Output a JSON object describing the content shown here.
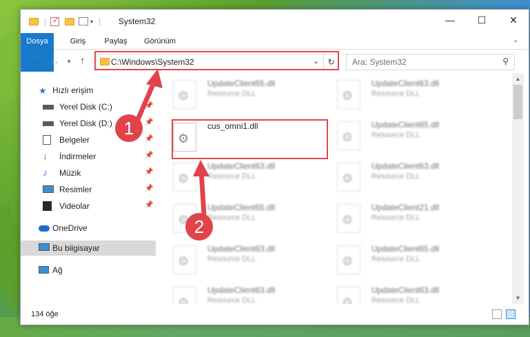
{
  "window": {
    "title": "System32",
    "controls": {
      "minimize": "—",
      "maximize": "☐",
      "close": "✕"
    }
  },
  "ribbon": {
    "tabs": [
      "Dosya",
      "Giriş",
      "Paylaş",
      "Görünüm"
    ]
  },
  "nav": {
    "address": "C:\\Windows\\System32",
    "search_placeholder": "Ara: System32"
  },
  "sidebar": {
    "items": [
      {
        "label": "Hızlı erişim",
        "icon": "star-icon"
      },
      {
        "label": "Yerel Disk (C:)",
        "icon": "drive-icon",
        "pinned": true
      },
      {
        "label": "Yerel Disk (D:)",
        "icon": "drive-icon",
        "pinned": true
      },
      {
        "label": "Belgeler",
        "icon": "documents-icon",
        "pinned": true
      },
      {
        "label": "İndirmeler",
        "icon": "download-icon",
        "pinned": true
      },
      {
        "label": "Müzik",
        "icon": "music-icon",
        "pinned": true
      },
      {
        "label": "Resimler",
        "icon": "pictures-icon",
        "pinned": true
      },
      {
        "label": "Videolar",
        "icon": "videos-icon",
        "pinned": true
      },
      {
        "label": "OneDrive",
        "icon": "cloud-icon"
      },
      {
        "label": "Bu bilgisayar",
        "icon": "computer-icon",
        "selected": true
      },
      {
        "label": "Ağ",
        "icon": "network-icon"
      }
    ]
  },
  "files": [
    {
      "name": "UpdateClient65.dll",
      "type": "Resource DLL"
    },
    {
      "name": "UpdateClient63.dll",
      "type": "Resource DLL"
    },
    {
      "name": "cus_omni1.dll",
      "type": ""
    },
    {
      "name": "UpdateClient65.dll",
      "type": "Resource DLL"
    },
    {
      "name": "UpdateClient63.dll",
      "type": "Resource DLL"
    },
    {
      "name": "UpdateClient63.dll",
      "type": "Resource DLL"
    },
    {
      "name": "UpdateClient65.dll",
      "type": "Resource DLL"
    },
    {
      "name": "UpdateClient21.dll",
      "type": "Resource DLL"
    },
    {
      "name": "UpdateClient63.dll",
      "type": "Resource DLL"
    },
    {
      "name": "UpdateClient65.dll",
      "type": "Resource DLL"
    },
    {
      "name": "UpdateClient63.dll",
      "type": "Resource DLL"
    },
    {
      "name": "UpdateClient63.dll",
      "type": "Resource DLL"
    }
  ],
  "status": {
    "count": "134 öğe"
  },
  "callouts": [
    "1",
    "2"
  ],
  "colors": {
    "accent": "#1979ca",
    "highlight": "#e0444b",
    "selected": "#d9d9d9"
  }
}
